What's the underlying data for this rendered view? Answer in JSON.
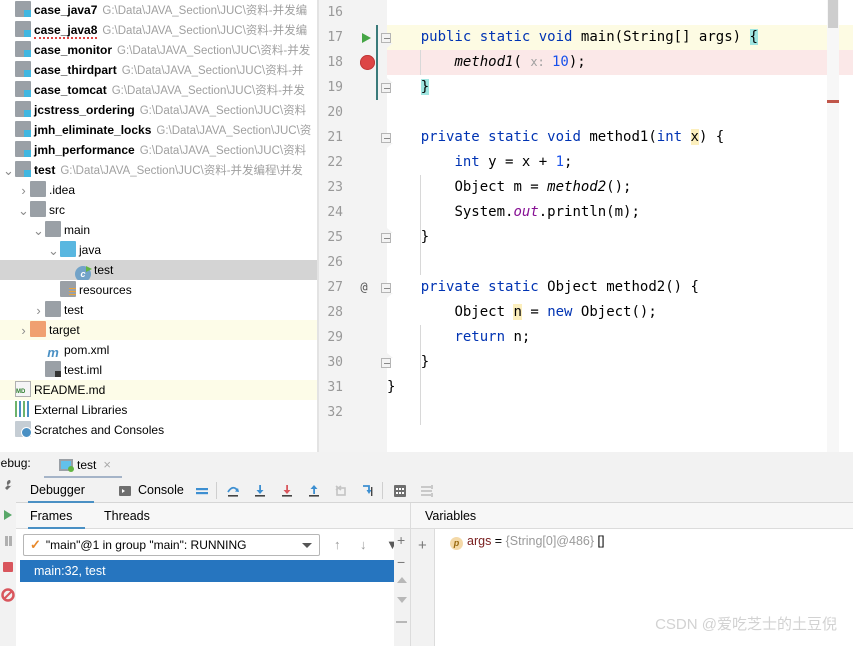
{
  "project_tree": {
    "items": [
      {
        "name": "case_java7",
        "path": "G:\\Data\\JAVA_Section\\JUC\\资料-并发编",
        "icon": "module-icon",
        "indent": 0,
        "arrow": "",
        "bold": true,
        "highlight": "none"
      },
      {
        "name": "case_java8",
        "path": "G:\\Data\\JAVA_Section\\JUC\\资料-并发编",
        "icon": "module-icon",
        "indent": 0,
        "arrow": "",
        "bold": true,
        "highlight": "none"
      },
      {
        "name": "case_monitor",
        "path": "G:\\Data\\JAVA_Section\\JUC\\资料-并发",
        "icon": "module-icon",
        "indent": 0,
        "arrow": "",
        "bold": true,
        "highlight": "none"
      },
      {
        "name": "case_thirdpart",
        "path": "G:\\Data\\JAVA_Section\\JUC\\资料-并",
        "icon": "module-icon",
        "indent": 0,
        "arrow": "",
        "bold": true,
        "highlight": "none"
      },
      {
        "name": "case_tomcat",
        "path": "G:\\Data\\JAVA_Section\\JUC\\资料-并发",
        "icon": "module-icon",
        "indent": 0,
        "arrow": "",
        "bold": true,
        "highlight": "none"
      },
      {
        "name": "jcstress_ordering",
        "path": "G:\\Data\\JAVA_Section\\JUC\\资料",
        "icon": "module-icon",
        "indent": 0,
        "arrow": "",
        "bold": true,
        "highlight": "none"
      },
      {
        "name": "jmh_eliminate_locks",
        "path": "G:\\Data\\JAVA_Section\\JUC\\资",
        "icon": "module-icon",
        "indent": 0,
        "arrow": "",
        "bold": true,
        "highlight": "none"
      },
      {
        "name": "jmh_performance",
        "path": "G:\\Data\\JAVA_Section\\JUC\\资料",
        "icon": "module-icon",
        "indent": 0,
        "arrow": "",
        "bold": true,
        "highlight": "none"
      },
      {
        "name": "test",
        "path": "G:\\Data\\JAVA_Section\\JUC\\资料-并发编程\\并发",
        "icon": "module-icon",
        "indent": 0,
        "arrow": "chevron-down",
        "bold": true,
        "highlight": "none"
      },
      {
        "name": ".idea",
        "path": "",
        "icon": "folder-icon",
        "indent": 1,
        "arrow": "chevron-right",
        "bold": false,
        "highlight": "none"
      },
      {
        "name": "src",
        "path": "",
        "icon": "folder-icon",
        "indent": 1,
        "arrow": "chevron-down",
        "bold": false,
        "highlight": "none"
      },
      {
        "name": "main",
        "path": "",
        "icon": "folder-icon",
        "indent": 2,
        "arrow": "chevron-down",
        "bold": false,
        "highlight": "none"
      },
      {
        "name": "java",
        "path": "",
        "icon": "source-folder-icon",
        "indent": 3,
        "arrow": "chevron-down",
        "bold": false,
        "highlight": "none"
      },
      {
        "name": "test",
        "path": "",
        "icon": "java-class-icon",
        "indent": 4,
        "arrow": "",
        "bold": false,
        "highlight": "selected"
      },
      {
        "name": "resources",
        "path": "",
        "icon": "resources-folder-icon",
        "indent": 3,
        "arrow": "",
        "bold": false,
        "highlight": "none"
      },
      {
        "name": "test",
        "path": "",
        "icon": "folder-icon",
        "indent": 2,
        "arrow": "chevron-right",
        "bold": false,
        "highlight": "none"
      },
      {
        "name": "target",
        "path": "",
        "icon": "target-folder-icon",
        "indent": 1,
        "arrow": "chevron-right",
        "bold": false,
        "highlight": "yellow"
      },
      {
        "name": "pom.xml",
        "path": "",
        "icon": "maven-icon",
        "indent": 2,
        "arrow": "",
        "bold": false,
        "highlight": "none"
      },
      {
        "name": "test.iml",
        "path": "",
        "icon": "iml-file-icon",
        "indent": 2,
        "arrow": "",
        "bold": false,
        "highlight": "none"
      },
      {
        "name": "README.md",
        "path": "",
        "icon": "markdown-icon",
        "indent": 0,
        "arrow": "",
        "bold": false,
        "highlight": "yellow"
      },
      {
        "name": "External Libraries",
        "path": "",
        "icon": "libraries-icon",
        "indent": 0,
        "arrow": "",
        "bold": false,
        "highlight": "none"
      },
      {
        "name": "Scratches and Consoles",
        "path": "",
        "icon": "scratches-icon",
        "indent": 0,
        "arrow": "",
        "bold": false,
        "highlight": "none"
      }
    ]
  },
  "editor": {
    "first_line": 16,
    "lines": [
      {
        "n": 16,
        "tokens": []
      },
      {
        "n": 17,
        "gutter_icon": "run-arrow-icon",
        "fold": "collapse-down",
        "tokens": [
          {
            "t": "    ",
            "c": "pl"
          },
          {
            "t": "public ",
            "c": "kw"
          },
          {
            "t": "static ",
            "c": "kw"
          },
          {
            "t": "void ",
            "c": "kw"
          },
          {
            "t": "main",
            "c": "pl"
          },
          {
            "t": "(",
            "c": "pl"
          },
          {
            "t": "String",
            "c": "pl"
          },
          {
            "t": "[] args) ",
            "c": "pl"
          },
          {
            "t": "{",
            "c": "brace-hl"
          }
        ]
      },
      {
        "n": 18,
        "gutter_icon": "breakpoint-icon",
        "tokens": [
          {
            "t": "        ",
            "c": "pl"
          },
          {
            "t": "method1",
            "c": "mth"
          },
          {
            "t": "( ",
            "c": "pl"
          },
          {
            "t": "x: ",
            "c": "hint"
          },
          {
            "t": "10",
            "c": "num"
          },
          {
            "t": ");",
            "c": "pl"
          }
        ]
      },
      {
        "n": 19,
        "fold": "collapse-up",
        "tokens": [
          {
            "t": "    ",
            "c": "pl"
          },
          {
            "t": "}",
            "c": "brace-hl"
          }
        ]
      },
      {
        "n": 20,
        "tokens": []
      },
      {
        "n": 21,
        "fold": "collapse-down",
        "tokens": [
          {
            "t": "    ",
            "c": "pl"
          },
          {
            "t": "private ",
            "c": "kw"
          },
          {
            "t": "static ",
            "c": "kw"
          },
          {
            "t": "void ",
            "c": "kw"
          },
          {
            "t": "method1",
            "c": "pl"
          },
          {
            "t": "(",
            "c": "pl"
          },
          {
            "t": "int ",
            "c": "kw"
          },
          {
            "t": "x",
            "c": "ident-hl"
          },
          {
            "t": ") {",
            "c": "pl"
          }
        ]
      },
      {
        "n": 22,
        "tokens": [
          {
            "t": "        ",
            "c": "pl"
          },
          {
            "t": "int ",
            "c": "kw"
          },
          {
            "t": "y = x + ",
            "c": "pl"
          },
          {
            "t": "1",
            "c": "num"
          },
          {
            "t": ";",
            "c": "pl"
          }
        ]
      },
      {
        "n": 23,
        "tokens": [
          {
            "t": "        ",
            "c": "pl"
          },
          {
            "t": "Object m = ",
            "c": "pl"
          },
          {
            "t": "method2",
            "c": "mth"
          },
          {
            "t": "();",
            "c": "pl"
          }
        ]
      },
      {
        "n": 24,
        "tokens": [
          {
            "t": "        ",
            "c": "pl"
          },
          {
            "t": "System.",
            "c": "pl"
          },
          {
            "t": "out",
            "c": "fld"
          },
          {
            "t": ".println(m);",
            "c": "pl"
          }
        ]
      },
      {
        "n": 25,
        "fold": "collapse-up",
        "tokens": [
          {
            "t": "    ",
            "c": "pl"
          },
          {
            "t": "}",
            "c": "pl"
          }
        ]
      },
      {
        "n": 26,
        "tokens": []
      },
      {
        "n": 27,
        "gutter_icon": "annotation-icon",
        "fold": "collapse-down",
        "tokens": [
          {
            "t": "    ",
            "c": "pl"
          },
          {
            "t": "private ",
            "c": "kw"
          },
          {
            "t": "static ",
            "c": "kw"
          },
          {
            "t": "Object ",
            "c": "pl"
          },
          {
            "t": "method2",
            "c": "pl"
          },
          {
            "t": "() {",
            "c": "pl"
          }
        ]
      },
      {
        "n": 28,
        "tokens": [
          {
            "t": "        ",
            "c": "pl"
          },
          {
            "t": "Object ",
            "c": "pl"
          },
          {
            "t": "n",
            "c": "ident-hl"
          },
          {
            "t": " = ",
            "c": "pl"
          },
          {
            "t": "new ",
            "c": "kw"
          },
          {
            "t": "Object();",
            "c": "pl"
          }
        ]
      },
      {
        "n": 29,
        "tokens": [
          {
            "t": "        ",
            "c": "pl"
          },
          {
            "t": "return ",
            "c": "kw"
          },
          {
            "t": "n;",
            "c": "pl"
          }
        ]
      },
      {
        "n": 30,
        "fold": "collapse-up",
        "tokens": [
          {
            "t": "    ",
            "c": "pl"
          },
          {
            "t": "}",
            "c": "pl"
          }
        ]
      },
      {
        "n": 31,
        "tokens": [
          {
            "t": "}",
            "c": "pl"
          }
        ]
      },
      {
        "n": 32,
        "tokens": []
      }
    ]
  },
  "debug_panel": {
    "title": "Debug:",
    "session_tab": {
      "label": "test",
      "close": "×"
    },
    "tool_tabs": [
      {
        "label": "Debugger",
        "icon": "debugger-icon",
        "active": true
      },
      {
        "label": "Console",
        "icon": "console-icon",
        "active": false
      }
    ],
    "toolbar_icons": [
      "layout-icon",
      "step-over-icon",
      "step-into-icon",
      "force-step-into-icon",
      "step-out-icon",
      "drop-frame-icon",
      "run-to-cursor-icon",
      "evaluate-expression-icon",
      "settings-icon"
    ],
    "left_actions": [
      "rerun-icon",
      "settings-icon",
      "resume-icon",
      "pause-icon",
      "stop-icon",
      "mute-breakpoints-icon"
    ],
    "frames": {
      "tabs": [
        {
          "label": "Frames",
          "active": true
        },
        {
          "label": "Threads",
          "active": false
        }
      ],
      "thread_selector": "\"main\"@1 in group \"main\": RUNNING",
      "stack": [
        "main:32, test"
      ],
      "buttons": [
        "arrow-up-icon",
        "arrow-down-icon",
        "filter-icon",
        "add-icon",
        "remove-icon"
      ]
    },
    "variables": {
      "header": "Variables",
      "rows": [
        {
          "badge": "p",
          "name": "args",
          "eq": " = ",
          "ref": "{String[0]@486}",
          "value": " []"
        }
      ]
    }
  },
  "watermark": "CSDN @爱吃芝士的土豆倪",
  "colors": {
    "keyword": "#0033B3",
    "number": "#1750EB",
    "field": "#871094",
    "exec_line": "#FDFBE3",
    "breakpoint_line": "#FBE8E8",
    "breakpoint": "#DD4646",
    "selection": "#2675BF",
    "tree_selected": "#D4D4D4",
    "tree_yellow": "#FDFCE8",
    "brace_match": "#9FE5E0",
    "identifier_highlight": "#FCEFBD"
  }
}
